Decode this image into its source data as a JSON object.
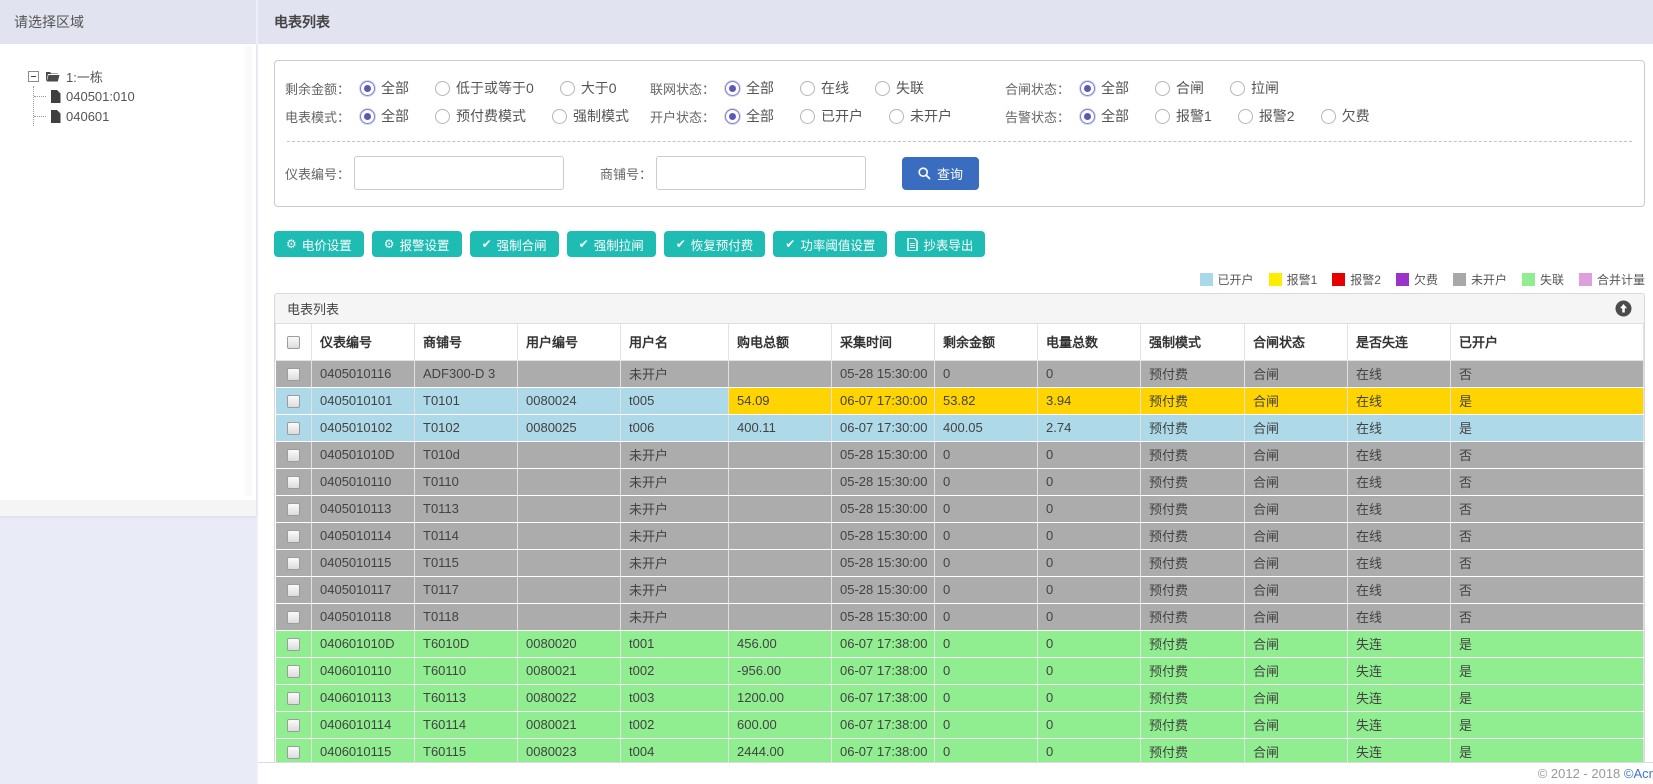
{
  "sidebar": {
    "title": "请选择区域",
    "tree": {
      "root_label": "1:一栋",
      "children": [
        "040501:010",
        "040601"
      ]
    }
  },
  "header": {
    "title": "电表列表"
  },
  "filters": {
    "groups": [
      [
        {
          "label": "剩余金额：",
          "options": [
            "全部",
            "低于或等于0",
            "大于0"
          ],
          "selected": 0
        },
        {
          "label": "联网状态：",
          "options": [
            "全部",
            "在线",
            "失联"
          ],
          "selected": 0
        },
        {
          "label": "合闸状态：",
          "options": [
            "全部",
            "合闸",
            "拉闸"
          ],
          "selected": 0
        }
      ],
      [
        {
          "label": "电表模式：",
          "options": [
            "全部",
            "预付费模式",
            "强制模式"
          ],
          "selected": 0
        },
        {
          "label": "开户状态：",
          "options": [
            "全部",
            "已开户",
            "未开户"
          ],
          "selected": 0
        },
        {
          "label": "告警状态：",
          "options": [
            "全部",
            "报警1",
            "报警2",
            "欠费"
          ],
          "selected": 0
        }
      ]
    ],
    "inputs": [
      {
        "label": "仪表编号：",
        "value": "",
        "key": "meter-no"
      },
      {
        "label": "商铺号：",
        "value": "",
        "key": "shop-no"
      }
    ],
    "search_label": "查询"
  },
  "actions": [
    {
      "icon": "gear",
      "label": "电价设置"
    },
    {
      "icon": "gear",
      "label": "报警设置"
    },
    {
      "icon": "check",
      "label": "强制合闸"
    },
    {
      "icon": "check",
      "label": "强制拉闸"
    },
    {
      "icon": "check",
      "label": "恢复预付费"
    },
    {
      "icon": "check",
      "label": "功率阈值设置"
    },
    {
      "icon": "doc",
      "label": "抄表导出"
    }
  ],
  "legend": [
    {
      "label": "已开户",
      "color": "#a9d8e8"
    },
    {
      "label": "报警1",
      "color": "#ffec00"
    },
    {
      "label": "报警2",
      "color": "#e60000"
    },
    {
      "label": "欠费",
      "color": "#9933cc"
    },
    {
      "label": "未开户",
      "color": "#a8a8a8"
    },
    {
      "label": "失联",
      "color": "#90ee90"
    },
    {
      "label": "合并计量",
      "color": "#dda0dd"
    }
  ],
  "table": {
    "panel_title": "电表列表",
    "columns": [
      "仪表编号",
      "商铺号",
      "用户编号",
      "用户名",
      "购电总额",
      "采集时间",
      "剩余金额",
      "电量总数",
      "强制模式",
      "合闸状态",
      "是否失连",
      "已开户"
    ],
    "row_colors": {
      "gray": "#acacac",
      "blue": "#aed9e8",
      "yellow": "#ffd400",
      "green": "#90ee90"
    },
    "rows": [
      {
        "color": "gray",
        "cells": [
          "0405010116",
          "ADF300-D 3",
          "",
          "未开户",
          "",
          "05-28 15:30:00",
          "0",
          "0",
          "预付费",
          "合闸",
          "在线",
          "否"
        ]
      },
      {
        "color": "blue",
        "highlight_from": 4,
        "highlight": "yellow",
        "cells": [
          "0405010101",
          "T0101",
          "0080024",
          "t005",
          "54.09",
          "06-07 17:30:00",
          "53.82",
          "3.94",
          "预付费",
          "合闸",
          "在线",
          "是"
        ]
      },
      {
        "color": "blue",
        "cells": [
          "0405010102",
          "T0102",
          "0080025",
          "t006",
          "400.11",
          "06-07 17:30:00",
          "400.05",
          "2.74",
          "预付费",
          "合闸",
          "在线",
          "是"
        ]
      },
      {
        "color": "gray",
        "cells": [
          "040501010D",
          "T010d",
          "",
          "未开户",
          "",
          "05-28 15:30:00",
          "0",
          "0",
          "预付费",
          "合闸",
          "在线",
          "否"
        ]
      },
      {
        "color": "gray",
        "cells": [
          "0405010110",
          "T0110",
          "",
          "未开户",
          "",
          "05-28 15:30:00",
          "0",
          "0",
          "预付费",
          "合闸",
          "在线",
          "否"
        ]
      },
      {
        "color": "gray",
        "cells": [
          "0405010113",
          "T0113",
          "",
          "未开户",
          "",
          "05-28 15:30:00",
          "0",
          "0",
          "预付费",
          "合闸",
          "在线",
          "否"
        ]
      },
      {
        "color": "gray",
        "cells": [
          "0405010114",
          "T0114",
          "",
          "未开户",
          "",
          "05-28 15:30:00",
          "0",
          "0",
          "预付费",
          "合闸",
          "在线",
          "否"
        ]
      },
      {
        "color": "gray",
        "cells": [
          "0405010115",
          "T0115",
          "",
          "未开户",
          "",
          "05-28 15:30:00",
          "0",
          "0",
          "预付费",
          "合闸",
          "在线",
          "否"
        ]
      },
      {
        "color": "gray",
        "cells": [
          "0405010117",
          "T0117",
          "",
          "未开户",
          "",
          "05-28 15:30:00",
          "0",
          "0",
          "预付费",
          "合闸",
          "在线",
          "否"
        ]
      },
      {
        "color": "gray",
        "cells": [
          "0405010118",
          "T0118",
          "",
          "未开户",
          "",
          "05-28 15:30:00",
          "0",
          "0",
          "预付费",
          "合闸",
          "在线",
          "否"
        ]
      },
      {
        "color": "green",
        "cells": [
          "040601010D",
          "T6010D",
          "0080020",
          "t001",
          "456.00",
          "06-07 17:38:00",
          "0",
          "0",
          "预付费",
          "合闸",
          "失连",
          "是"
        ]
      },
      {
        "color": "green",
        "cells": [
          "0406010110",
          "T60110",
          "0080021",
          "t002",
          "-956.00",
          "06-07 17:38:00",
          "0",
          "0",
          "预付费",
          "合闸",
          "失连",
          "是"
        ]
      },
      {
        "color": "green",
        "cells": [
          "0406010113",
          "T60113",
          "0080022",
          "t003",
          "1200.00",
          "06-07 17:38:00",
          "0",
          "0",
          "预付费",
          "合闸",
          "失连",
          "是"
        ]
      },
      {
        "color": "green",
        "cells": [
          "0406010114",
          "T60114",
          "0080021",
          "t002",
          "600.00",
          "06-07 17:38:00",
          "0",
          "0",
          "预付费",
          "合闸",
          "失连",
          "是"
        ]
      },
      {
        "color": "green",
        "cells": [
          "0406010115",
          "T60115",
          "0080023",
          "t004",
          "2444.00",
          "06-07 17:38:00",
          "0",
          "0",
          "预付费",
          "合闸",
          "失连",
          "是"
        ]
      }
    ]
  },
  "footer": {
    "copyright": "© 2012 - 2018 ",
    "link_text": "©Acr"
  },
  "colors": {
    "header_bar": "#e2e3f1",
    "search_button": "#3a6dbf",
    "action_button": "#1fbcb4",
    "radio_accent": "#5a5ab5"
  }
}
